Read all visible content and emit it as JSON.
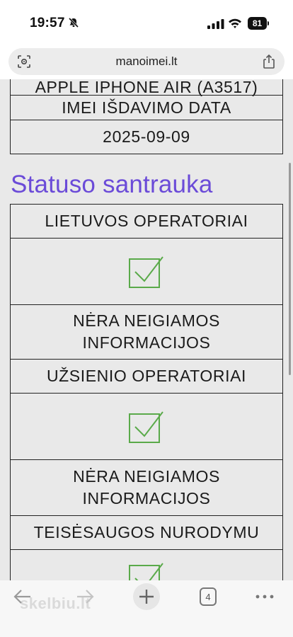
{
  "status_bar": {
    "time": "19:57",
    "battery": "81"
  },
  "browser": {
    "url": "manoimei.lt",
    "tab_count": "4"
  },
  "top_table": [
    {
      "text": "APPLE IPHONE AIR (A3517)"
    },
    {
      "text": "IMEI IŠDAVIMO DATA"
    },
    {
      "text": "2025-09-09"
    }
  ],
  "section": {
    "title": "Statuso santrauka"
  },
  "status_table": {
    "lithuanian_header": "LIETUVOS OPERATORIAI",
    "lithuanian_result": "NĖRA NEIGIAMOS INFORMACIJOS",
    "foreign_header": "UŽSIENIO OPERATORIAI",
    "foreign_result": "NĖRA NEIGIAMOS INFORMACIJOS",
    "law_header": "TEISĖSAUGOS NURODYMU"
  },
  "watermark": "skelbiu.lt",
  "colors": {
    "accent": "#6b4bd8",
    "check": "#5aaa4a"
  }
}
